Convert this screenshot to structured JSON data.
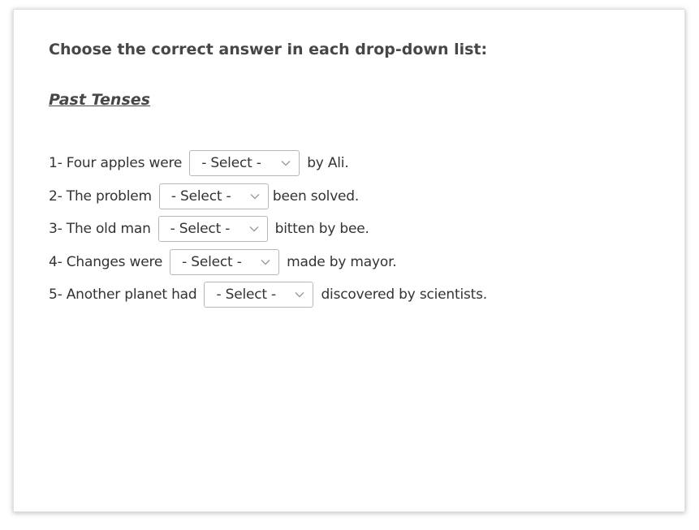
{
  "instruction": "Choose the correct answer in each drop-down list:",
  "section_title": "Past Tenses",
  "questions": [
    {
      "before": "1- Four apples were",
      "select_value": "- Select -",
      "after": "by Ali."
    },
    {
      "before": "2- The problem",
      "select_value": "- Select -",
      "after": "been solved."
    },
    {
      "before": "3- The old man",
      "select_value": "- Select -",
      "after": "bitten by bee."
    },
    {
      "before": "4- Changes were",
      "select_value": "- Select -",
      "after": "made by mayor."
    },
    {
      "before": "5- Another planet had",
      "select_value": "- Select -",
      "after": "discovered by scientists."
    }
  ],
  "icons": {
    "select_arrow": "chevron-down-icon"
  },
  "colors": {
    "text": "#333333",
    "heading": "#474747",
    "select_border": "#b7b7b7",
    "chevron": "#9a9a9a",
    "card_border": "#e2e2e2"
  }
}
